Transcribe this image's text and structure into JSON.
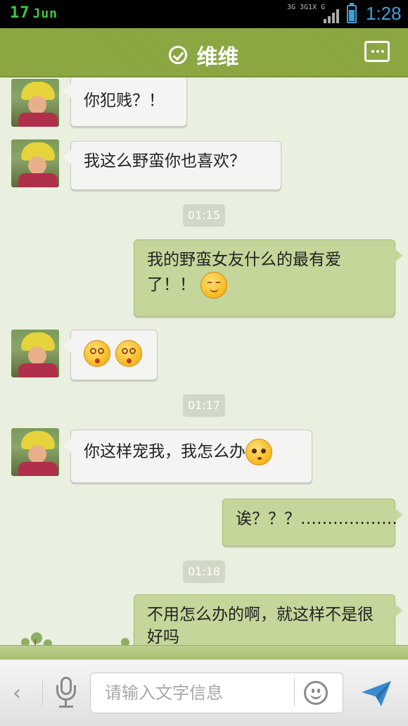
{
  "status_bar": {
    "date_day": "17",
    "date_month": "Jun",
    "network_icons": "3G 3G1X G",
    "time": "1:28"
  },
  "header": {
    "title": "维维",
    "verified_icon": "check-circle-icon",
    "more_icon": "more-dots-icon"
  },
  "messages": [
    {
      "side": "in",
      "text": "你犯贱？！"
    },
    {
      "side": "in",
      "text": "我这么野蛮你也喜欢？"
    },
    {
      "type": "time",
      "text": "01:15"
    },
    {
      "side": "out",
      "text": "我的野蛮女友什么的最有爱了！！",
      "emoji": "smile-emoji"
    },
    {
      "side": "in",
      "text": "",
      "emoji": "dizzy-emoji x2"
    },
    {
      "type": "time",
      "text": "01:17"
    },
    {
      "side": "in",
      "text": "你这样宠我，我怎么办",
      "emoji": "shy-emoji"
    },
    {
      "side": "out",
      "text": "诶？？？………………"
    },
    {
      "type": "time",
      "text": "01:18"
    },
    {
      "side": "out",
      "text": "不用怎么办的啊，就这样不是很好吗"
    }
  ],
  "input_bar": {
    "placeholder": "请输入文字信息",
    "value": "",
    "icons": [
      "chevron-left-icon",
      "microphone-icon",
      "smiley-icon",
      "send-icon"
    ]
  },
  "colors": {
    "header": "#8aa640",
    "outgoing_bubble": "#c4d69a",
    "incoming_bubble": "#f4f4f2",
    "background": "#e9f0df",
    "time_accent": "#3fa0d8"
  }
}
